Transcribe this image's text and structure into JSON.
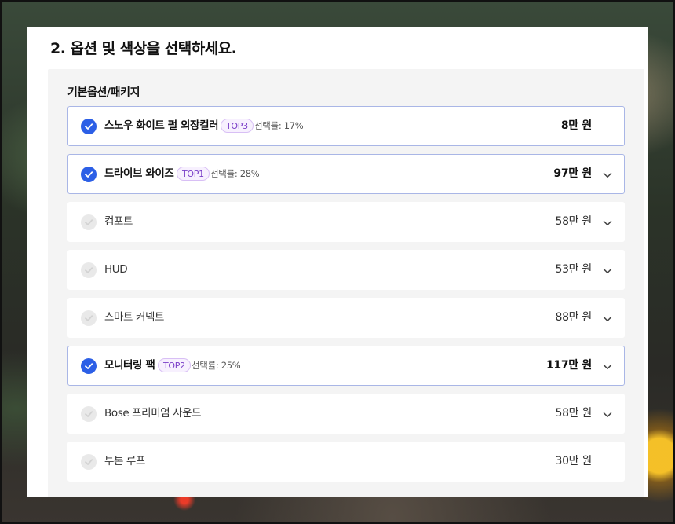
{
  "section": {
    "title": "2. 옵션 및 색상을 선택하세요."
  },
  "group": {
    "label": "기본옵션/패키지"
  },
  "options": [
    {
      "name": "스노우 화이트 펄 외장컬러",
      "selected": true,
      "badge": "TOP3",
      "rate": "선택률: 17%",
      "price": "8만 원",
      "expandable": false
    },
    {
      "name": "드라이브 와이즈",
      "selected": true,
      "badge": "TOP1",
      "rate": "선택률: 28%",
      "price": "97만 원",
      "expandable": true
    },
    {
      "name": "컴포트",
      "selected": false,
      "badge": "",
      "rate": "",
      "price": "58만 원",
      "expandable": true
    },
    {
      "name": "HUD",
      "selected": false,
      "badge": "",
      "rate": "",
      "price": "53만 원",
      "expandable": true
    },
    {
      "name": "스마트 커넥트",
      "selected": false,
      "badge": "",
      "rate": "",
      "price": "88만 원",
      "expandable": true
    },
    {
      "name": "모니터링 팩",
      "selected": true,
      "badge": "TOP2",
      "rate": "선택률: 25%",
      "price": "117만 원",
      "expandable": true
    },
    {
      "name": "Bose 프리미엄 사운드",
      "selected": false,
      "badge": "",
      "rate": "",
      "price": "58만 원",
      "expandable": true
    },
    {
      "name": "투톤 루프",
      "selected": false,
      "badge": "",
      "rate": "",
      "price": "30만 원",
      "expandable": false
    }
  ],
  "colors": {
    "accent": "#2c5fe6",
    "badge_text": "#7a3ec8",
    "selected_border": "#a9b6e6"
  },
  "icons": {
    "check": "check-icon",
    "expand": "chevron-down-icon"
  }
}
